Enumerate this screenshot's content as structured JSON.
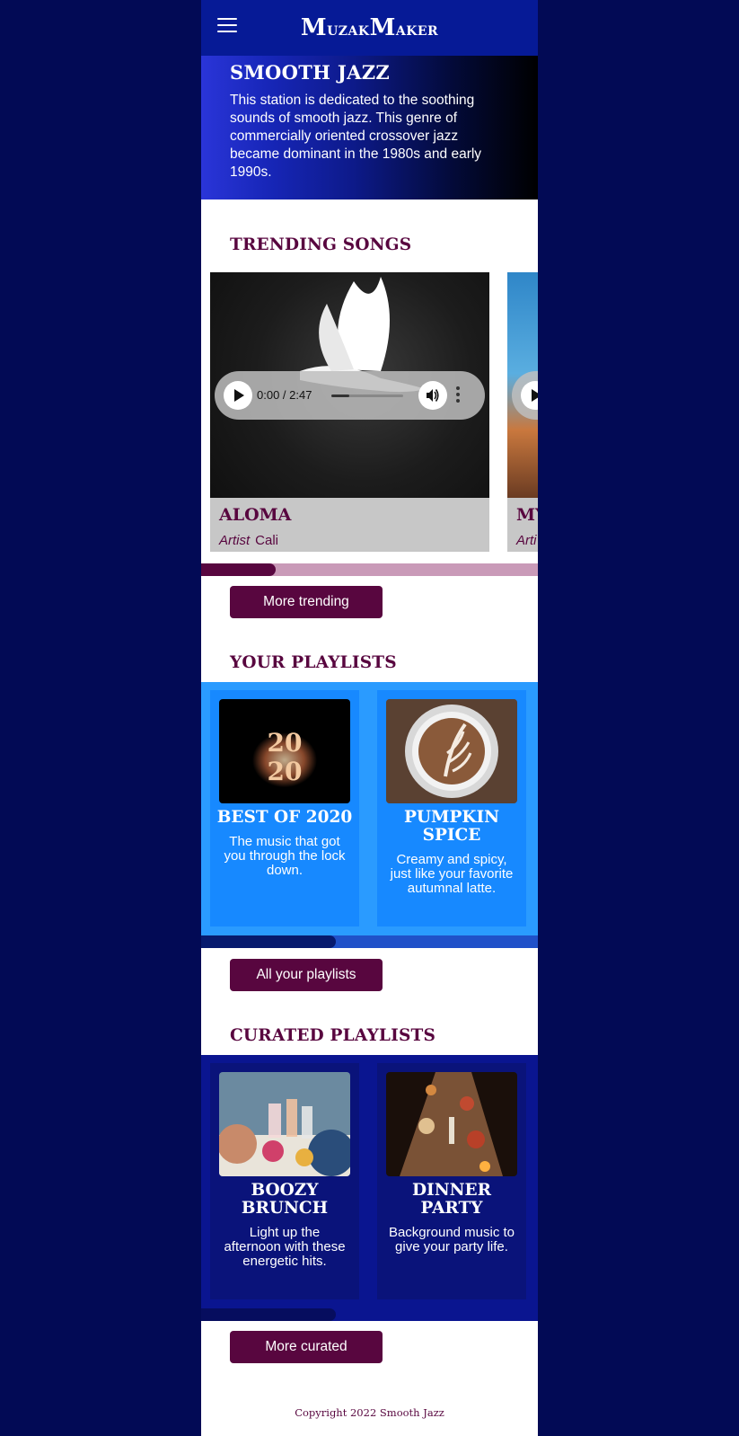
{
  "app": {
    "logo_first": "M",
    "logo_rest1": "uzak",
    "logo_second": "M",
    "logo_rest2": "aker"
  },
  "hero": {
    "title": "SMOOTH JAZZ",
    "description": "This station is dedicated to the soothing sounds of smooth jazz. This genre of commercially oriented crossover jazz became dominant in the 1980s and early 1990s."
  },
  "trending": {
    "title": "TRENDING SONGS",
    "songs": [
      {
        "title": "ALOMA",
        "artist_label": "Artist",
        "artist": "Cali",
        "time": "0:00 / 2:47",
        "art_icon": "dove-image"
      },
      {
        "title": "MY",
        "artist_label": "Arti",
        "artist": "",
        "art_icon": "desert-road-image"
      }
    ],
    "scroll_position": 0.22,
    "button": "More trending"
  },
  "your_playlists": {
    "title": "YOUR PLAYLISTS",
    "items": [
      {
        "title": "BEST OF 2020",
        "description": "The music that got you through the lock down.",
        "image_icon": "2020-sparkler-image"
      },
      {
        "title": "PUMPKIN SPICE",
        "description": "Creamy and spicy, just like your favorite autumnal latte.",
        "image_icon": "latte-art-image"
      }
    ],
    "scroll_position": 0.4,
    "button": "All your playlists"
  },
  "curated": {
    "title": "CURATED PLAYLISTS",
    "items": [
      {
        "title": "BOOZY BRUNCH",
        "description": "Light up the afternoon with these energetic hits.",
        "image_icon": "brunch-toast-image"
      },
      {
        "title": "DINNER PARTY",
        "description": "Background music to give your party life.",
        "image_icon": "dinner-table-image"
      }
    ],
    "scroll_position": 0.4,
    "button": "More curated"
  },
  "footer": {
    "text": "Copyright 2022 Smooth Jazz"
  },
  "colors": {
    "brand_purple": "#58063f",
    "header_blue": "#061a96",
    "playlist_blue": "#2a9bff",
    "curated_navy": "#0a1590",
    "page_bg": "#020a55"
  }
}
